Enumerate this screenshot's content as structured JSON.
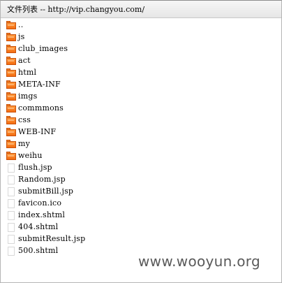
{
  "header": {
    "title": "文件列表 -- http://vip.changyou.com/"
  },
  "items": [
    {
      "name": "..",
      "kind": "folder",
      "icon": "folder-icon"
    },
    {
      "name": "js",
      "kind": "folder",
      "icon": "folder-icon"
    },
    {
      "name": "club_images",
      "kind": "folder",
      "icon": "folder-icon"
    },
    {
      "name": "act",
      "kind": "folder",
      "icon": "folder-icon"
    },
    {
      "name": "html",
      "kind": "folder",
      "icon": "folder-icon"
    },
    {
      "name": "META-INF",
      "kind": "folder",
      "icon": "folder-icon"
    },
    {
      "name": "imgs",
      "kind": "folder",
      "icon": "folder-icon"
    },
    {
      "name": "commmons",
      "kind": "folder",
      "icon": "folder-icon"
    },
    {
      "name": "css",
      "kind": "folder",
      "icon": "folder-icon"
    },
    {
      "name": "WEB-INF",
      "kind": "folder",
      "icon": "folder-icon"
    },
    {
      "name": "my",
      "kind": "folder",
      "icon": "folder-icon"
    },
    {
      "name": "weihu",
      "kind": "folder",
      "icon": "folder-icon"
    },
    {
      "name": "flush.jsp",
      "kind": "file",
      "icon": "file-icon"
    },
    {
      "name": "Random.jsp",
      "kind": "file",
      "icon": "file-icon"
    },
    {
      "name": "submitBill.jsp",
      "kind": "file",
      "icon": "file-icon"
    },
    {
      "name": "favicon.ico",
      "kind": "file",
      "icon": "file-icon"
    },
    {
      "name": "index.shtml",
      "kind": "file",
      "icon": "file-icon"
    },
    {
      "name": "404.shtml",
      "kind": "file",
      "icon": "file-icon"
    },
    {
      "name": "submitResult.jsp",
      "kind": "file",
      "icon": "file-icon"
    },
    {
      "name": "500.shtml",
      "kind": "file",
      "icon": "file-icon"
    }
  ],
  "watermark": {
    "text": "www.wooyun.org"
  },
  "colors": {
    "folder": "#f36b10",
    "header_bg": "#ececec"
  }
}
